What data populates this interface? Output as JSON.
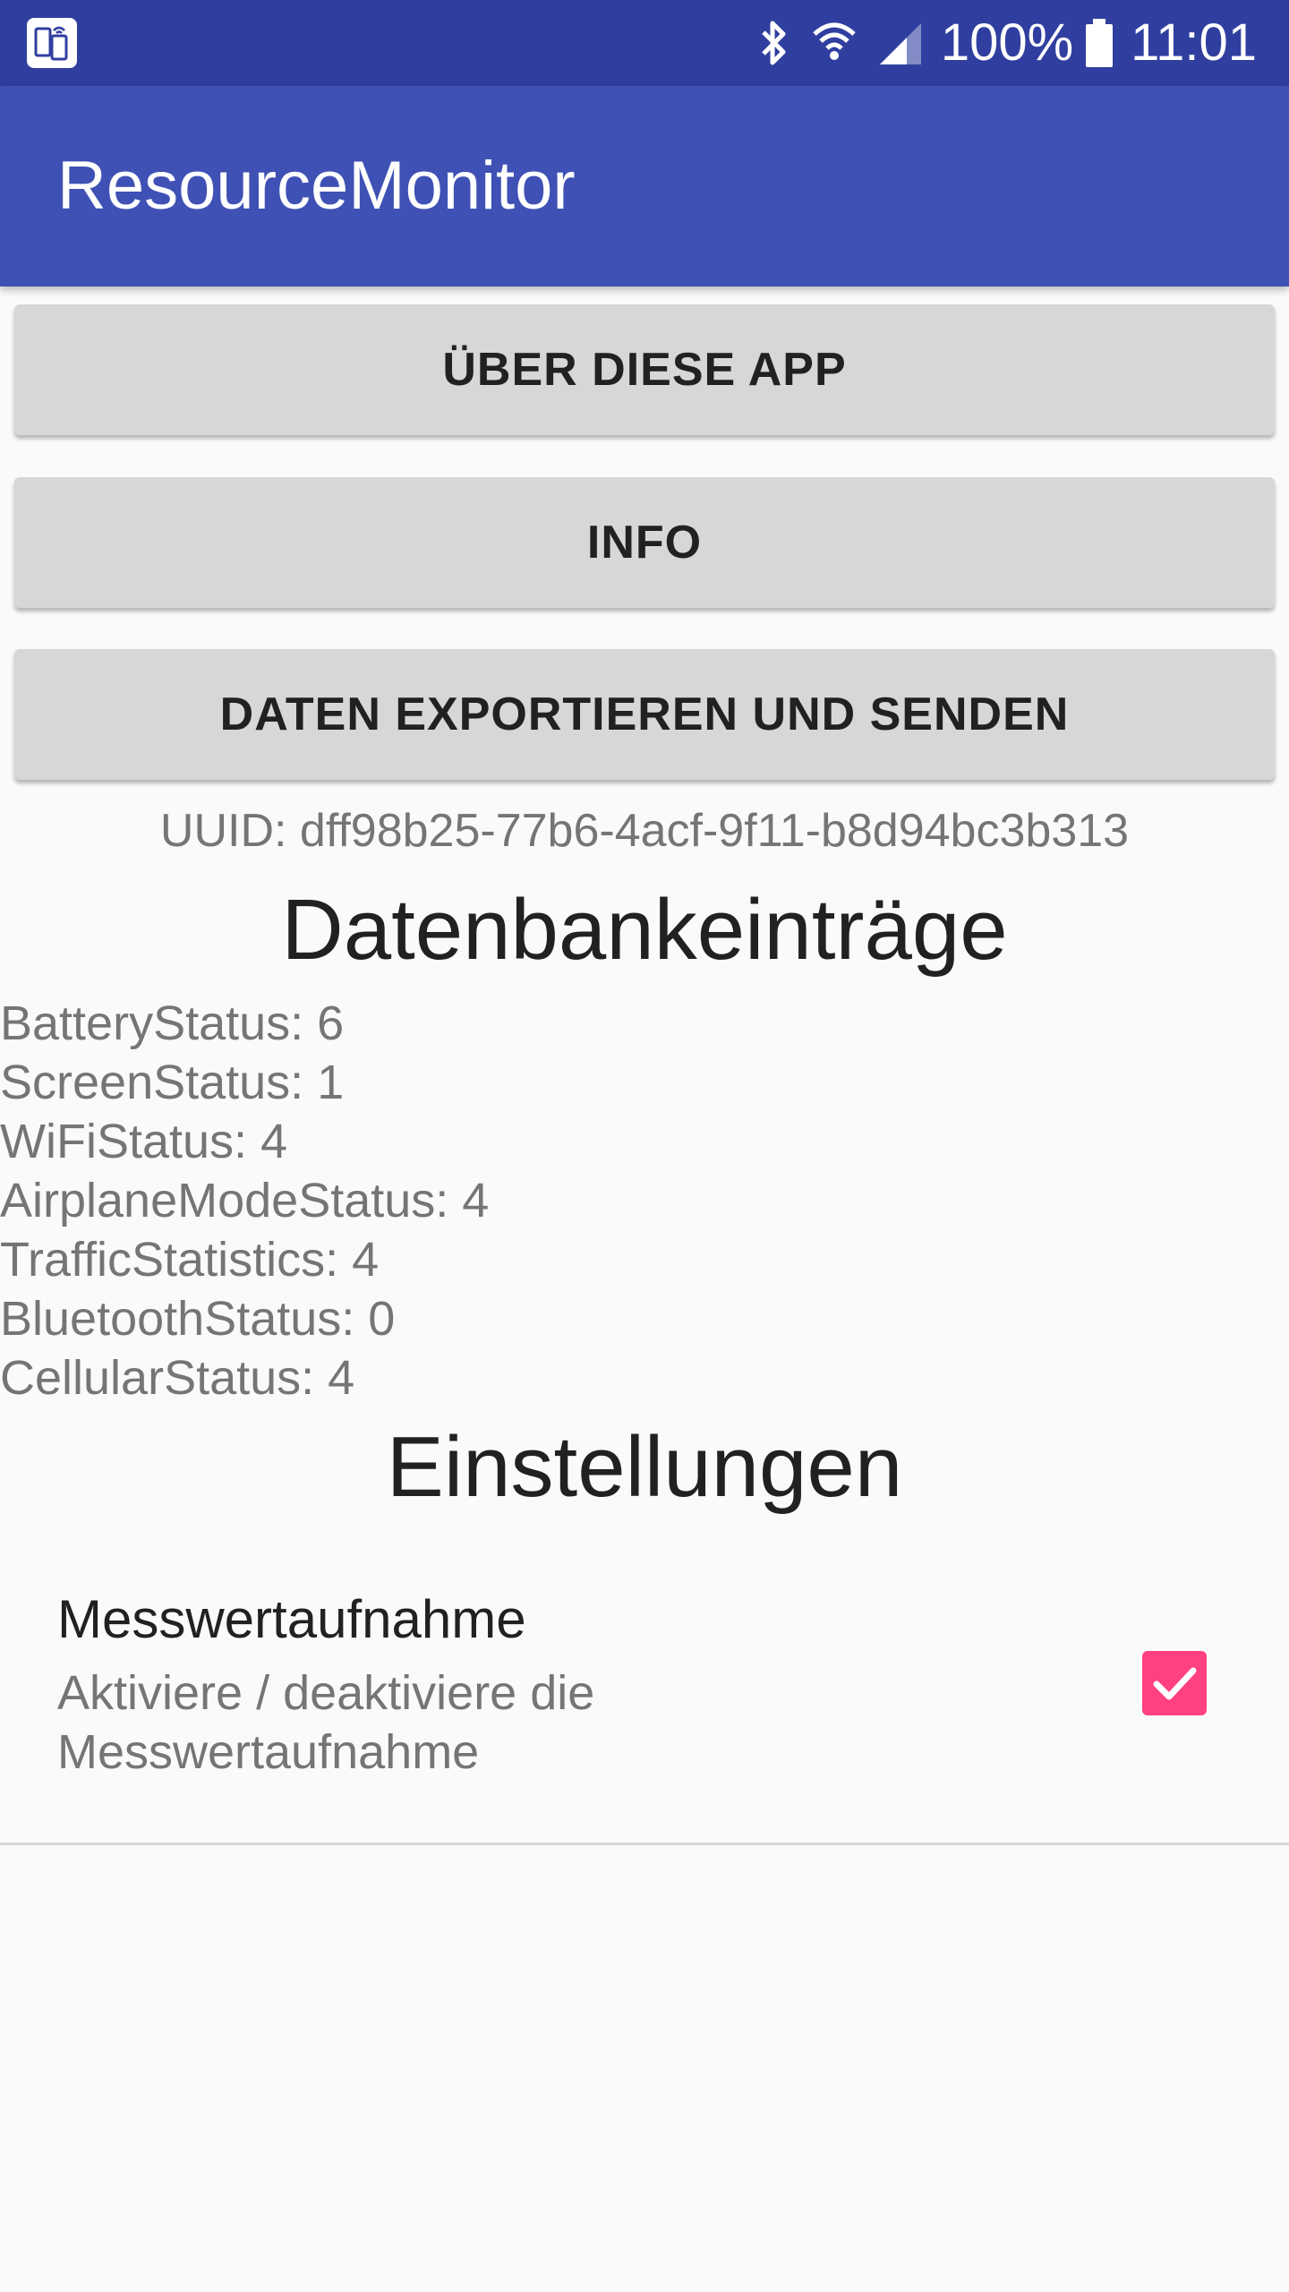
{
  "status_bar": {
    "battery": "100%",
    "time": "11:01",
    "icons": [
      "app-notification-icon",
      "bluetooth-icon",
      "wifi-icon",
      "cellular-signal-icon",
      "battery-icon"
    ]
  },
  "app_bar": {
    "title": "ResourceMonitor",
    "color": "#3f51b5",
    "status_color": "#303f9f"
  },
  "buttons": {
    "about": "ÜBER DIESE APP",
    "info": "INFO",
    "export": "DATEN EXPORTIEREN UND SENDEN"
  },
  "uuid": "UUID: dff98b25-77b6-4acf-9f11-b8d94bc3b313",
  "database": {
    "heading": "Datenbankeinträge",
    "entries": [
      "BatteryStatus: 6",
      "ScreenStatus: 1",
      "WiFiStatus: 4",
      "AirplaneModeStatus: 4",
      "TrafficStatistics: 4",
      "BluetoothStatus: 0",
      "CellularStatus: 4"
    ]
  },
  "settings": {
    "heading": "Einstellungen",
    "preference": {
      "title": "Messwertaufnahme",
      "summary": "Aktiviere / deaktiviere die Messwertaufnahme",
      "checked": true,
      "accent_color": "#ff4081"
    }
  }
}
